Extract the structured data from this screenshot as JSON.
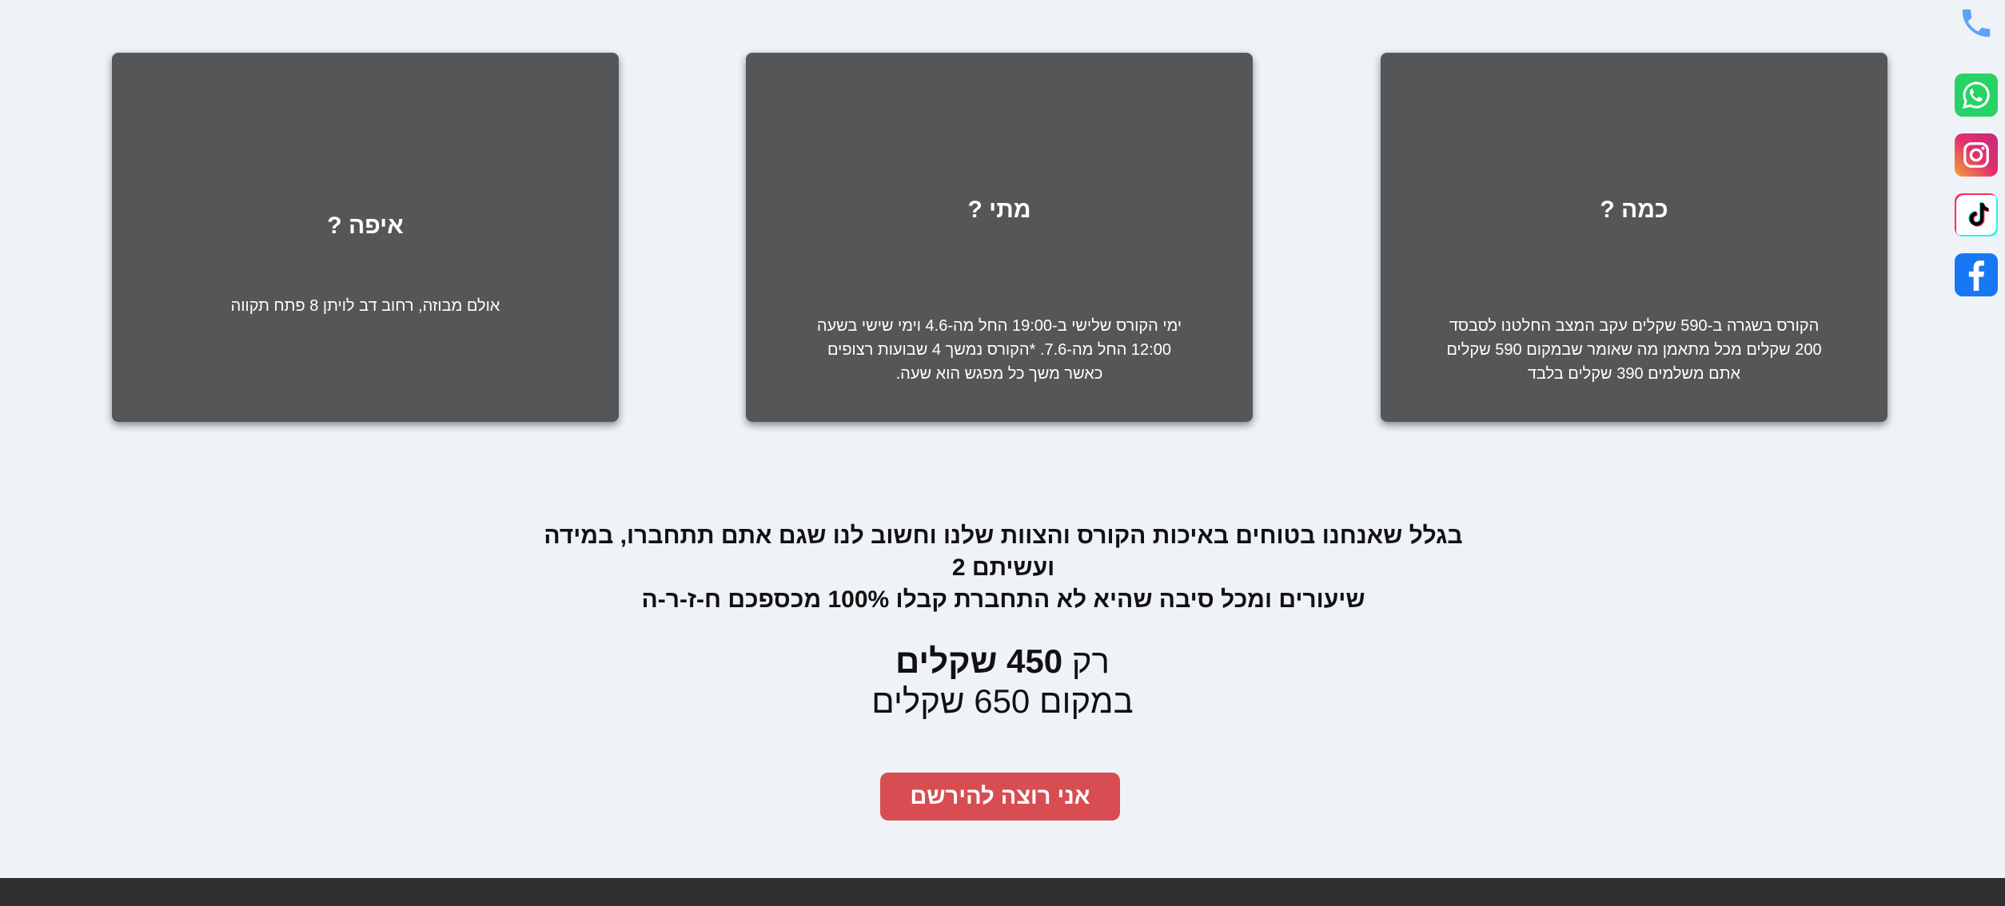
{
  "cards": [
    {
      "id": "where",
      "title": "איפה ?",
      "body": [
        "אולם מבוזה, רחוב דב לויתן 8 פתח תקווה"
      ]
    },
    {
      "id": "when",
      "title": "מתי ?",
      "body": [
        "ימי הקורס שלישי ב-19:00 החל מה-4.6 וימי שישי בשעה",
        "12:00 החל מה-7.6. *הקורס נמשך 4 שבועות רצופים",
        "כאשר משך כל מפגש הוא שעה."
      ]
    },
    {
      "id": "howmuch",
      "title": "כמה ?",
      "body": [
        "הקורס בשגרה ב-590 שקלים עקב המצב החלטנו לסבסד",
        "200 שקלים מכל מתאמן מה שאומר שבמקום 590 שקלים",
        "אתם משלמים 390 שקלים בלבד"
      ]
    }
  ],
  "guarantee": {
    "line1": "בגלל שאנחנו בטוחים באיכות הקורס והצוות שלנו וחשוב לנו שגם אתם תתחברו, במידה ועשיתם 2",
    "line2": "שיעורים ומכל סיבה שהיא לא התחברת קבלו 100% מכספכם ח-ז-ר-ה"
  },
  "price": {
    "prefix": "רק",
    "amount": "450 שקלים",
    "instead": "במקום 650 שקלים"
  },
  "cta_label": "אני רוצה להירשם",
  "social_icons": [
    "phone-icon",
    "whatsapp-icon",
    "instagram-icon",
    "tiktok-icon",
    "facebook-icon"
  ],
  "colors": {
    "background": "#eff3f8",
    "card": "#555658",
    "cta": "#d84d51",
    "footer": "#2f2f31",
    "whatsapp": "#27d366",
    "facebook": "#1877f2",
    "phone": "#5fa4f3"
  }
}
